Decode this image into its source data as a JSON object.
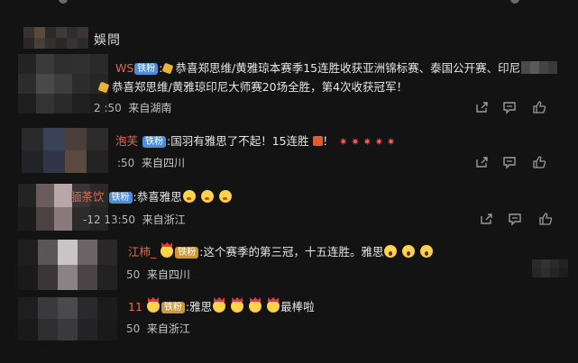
{
  "section_title": "娛問",
  "actions": {
    "share": "share-icon",
    "comment": "comment-icon",
    "like": "like-icon"
  },
  "comments": [
    {
      "name_visible": "WS",
      "badge": "铁粉",
      "text1": "恭喜郑思维/黄雅琼本赛季15连胜收获亚洲锦标赛、泰国公开赛、印尼大师",
      "text2": "恭喜郑思维/黄雅琼印尼大师赛20场全胜，第4次收获冠军！",
      "time": "2  :50",
      "ip": "来自湖南"
    },
    {
      "name_visible": "泡芙",
      "badge": "铁粉",
      "text": "国羽有雅思了不起！15连胜",
      "text_tail": "！",
      "time": ":50",
      "ip": "来自四川"
    },
    {
      "name_visible": "腼茶饮",
      "badge": "铁粉",
      "text": "恭喜雅思",
      "time": "-12 13:50",
      "ip": "来自浙江"
    },
    {
      "name_visible": "江柿_",
      "badge": "铁粉",
      "text": "这个赛季的第三冠，十五连胜。雅思",
      "time": "50",
      "ip": "来自四川"
    },
    {
      "name_visible": "11",
      "badge": "铁粉",
      "text_pre": "雅思",
      "text_post": "最棒啦",
      "time": "50",
      "ip": "来自浙江"
    }
  ]
}
